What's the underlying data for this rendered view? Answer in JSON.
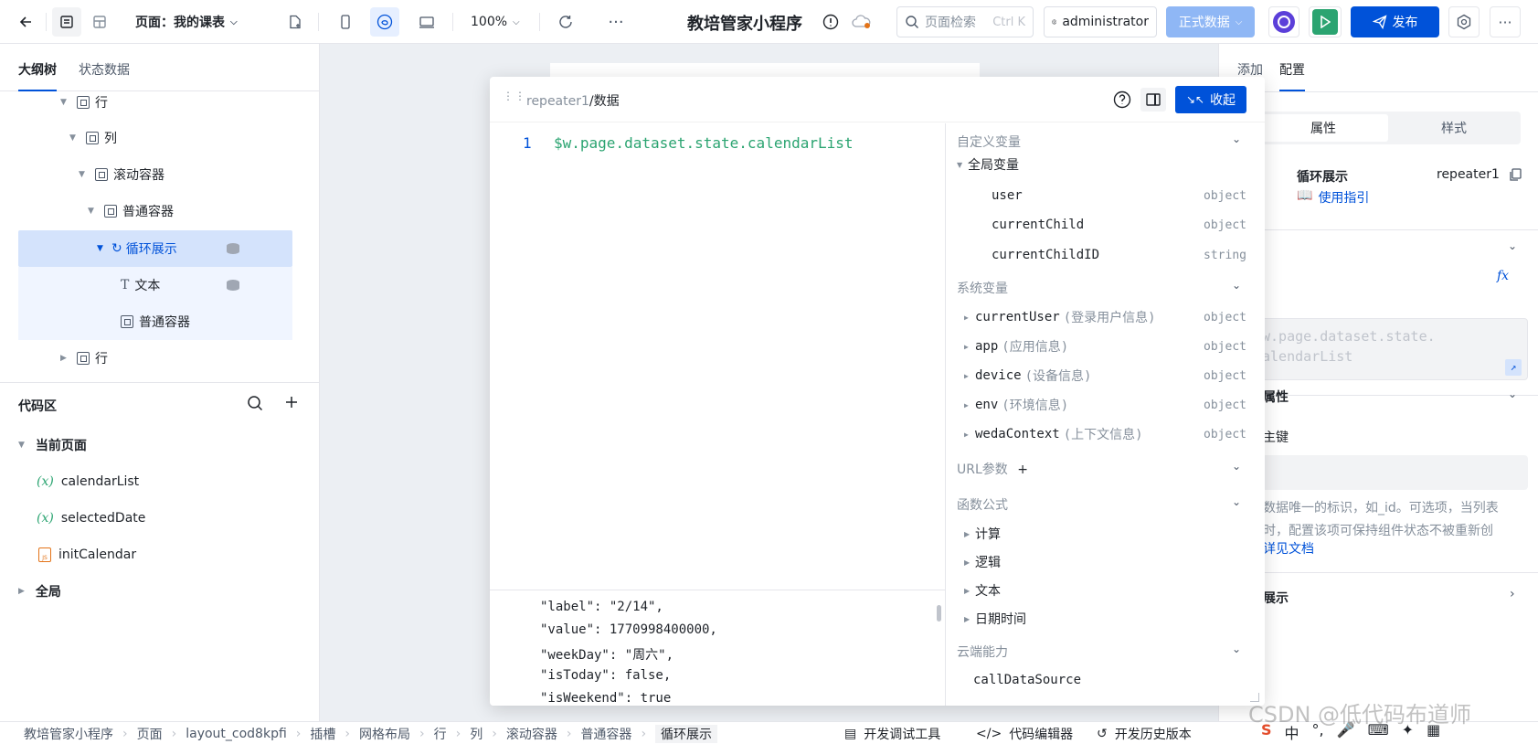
{
  "topbar": {
    "page_label": "页面：我的课表",
    "zoom": "100%",
    "app_title": "教培管家小程序",
    "search_placeholder": "页面检索",
    "search_shortcut": "Ctrl K",
    "user": "administrator",
    "env": "正式数据",
    "publish": "发布",
    "colors": {
      "primary": "#0052d9",
      "run": "#2ba471",
      "env": "#8fb7f5"
    }
  },
  "left_panel": {
    "tabs": [
      "大纲树",
      "状态数据"
    ],
    "tree": [
      {
        "label": "行"
      },
      {
        "label": "列"
      },
      {
        "label": "滚动容器"
      },
      {
        "label": "普通容器"
      },
      {
        "label": "循环展示"
      },
      {
        "label": "文本"
      },
      {
        "label": "普通容器"
      },
      {
        "label": "行"
      }
    ],
    "code_area": {
      "title": "代码区",
      "current_page": "当前页面",
      "items": [
        "calendarList",
        "selectedDate",
        "initCalendar"
      ],
      "global": "全局"
    }
  },
  "modal": {
    "breadcrumb_parent": "repeater1",
    "breadcrumb_current": "/数据",
    "collapse": "收起",
    "line_number": "1",
    "code": "$w.page.dataset.state.calendarList",
    "preview_lines": [
      "\"label\": \"2/14\",",
      "\"value\": 1770998400000,",
      "\"weekDay\": \"周六\",",
      "\"isToday\": false,",
      "\"isWeekend\": true"
    ],
    "sections": {
      "custom": "自定义变量",
      "global": "全局变量",
      "system": "系统变量",
      "url": "URL参数",
      "func": "函数公式",
      "cloud": "云端能力"
    },
    "global_vars": [
      {
        "name": "user",
        "type": "object"
      },
      {
        "name": "currentChild",
        "type": "object"
      },
      {
        "name": "currentChildID",
        "type": "string"
      }
    ],
    "system_vars": [
      {
        "name": "currentUser",
        "desc": "(登录用户信息)",
        "type": "object"
      },
      {
        "name": "app",
        "desc": "(应用信息)",
        "type": "object"
      },
      {
        "name": "device",
        "desc": "(设备信息)",
        "type": "object"
      },
      {
        "name": "env",
        "desc": "(环境信息)",
        "type": "object"
      },
      {
        "name": "wedaContext",
        "desc": "(上下文信息)",
        "type": "object"
      }
    ],
    "funcs": [
      "计算",
      "逻辑",
      "文本",
      "日期时间"
    ],
    "cloud_first": "callDataSource"
  },
  "right_panel": {
    "tabs": [
      "添加",
      "配置"
    ],
    "seg": [
      "属性",
      "样式"
    ],
    "component_name": "循环展示",
    "component_id": "repeater1",
    "guide": "使用指引",
    "fx_text": "w.page.dataset.state.\nalendarList",
    "attr_section": "属性",
    "key_label": "主键",
    "key_help": "数据唯一的标识，如_id。可选项，当列表\n时，配置该项可保持组件状态不被重新创",
    "doc_link": "详见文档",
    "display_section": "展示"
  },
  "statusbar": {
    "crumbs": [
      "教培管家小程序",
      "页面",
      "layout_cod8kpfi",
      "插槽",
      "网格布局",
      "行",
      "列",
      "滚动容器",
      "普通容器",
      "循环展示"
    ],
    "tools": [
      "开发调试工具",
      "代码编辑器",
      "开发历史版本"
    ],
    "watermark": "CSDN @低代码布道师",
    "tray": [
      "中"
    ]
  }
}
